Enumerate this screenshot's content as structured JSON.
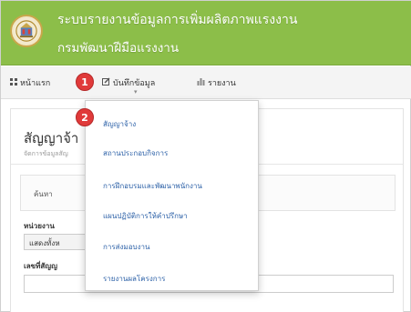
{
  "header": {
    "title_line1": "ระบบรายงานข้อมูลการเพิ่มผลิตภาพแรงงาน",
    "title_line2": "กรมพัฒนาฝีมือแรงงาน"
  },
  "nav": {
    "home_label": "หน้าแรก",
    "record_label": "บันทึกข้อมูล",
    "report_label": "รายงาน"
  },
  "annotations": {
    "step1": "1",
    "step2": "2"
  },
  "dropdown": {
    "items": [
      {
        "label": "สัญญาจ้าง"
      },
      {
        "label": "สถานประกอบกิจการ"
      },
      {
        "label": "การฝึกอบรมและพัฒนาพนักงาน"
      },
      {
        "label": "แผนปฏิบัติการให้คำปรึกษา"
      },
      {
        "label": "การส่งมอบงาน"
      },
      {
        "label": "รายงานผลโครงการ"
      }
    ]
  },
  "page": {
    "title": "สัญญาจ้า",
    "subtitle": "จัดการข้อมูลสัญ",
    "search_label": "ค้นหา",
    "unit_label": "หน่วยงาน",
    "unit_value": "แสดงทั้งห",
    "contract_label": "เลขที่สัญญ"
  },
  "colors": {
    "header_green": "#8cbe49",
    "badge_red": "#e03a3a",
    "link_blue": "#2e62a8"
  },
  "icons": {
    "home": "grid-icon",
    "record": "edit-icon",
    "report": "bar-chart-icon"
  }
}
